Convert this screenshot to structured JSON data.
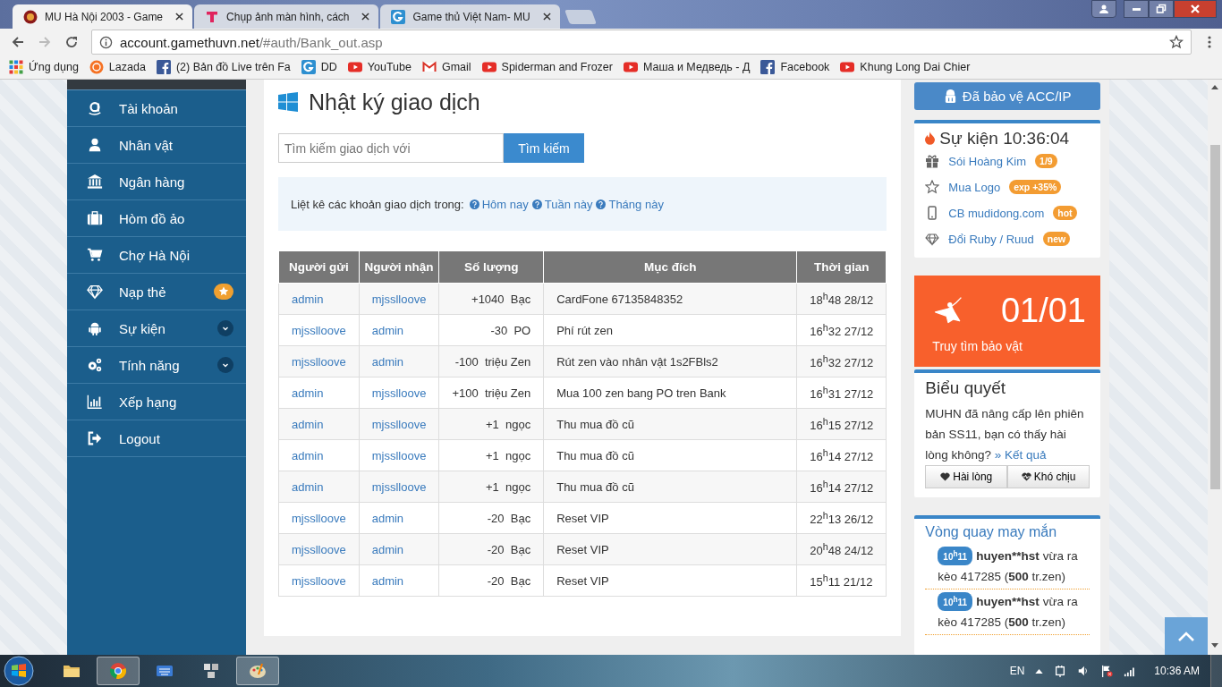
{
  "browser": {
    "tabs": [
      {
        "title": "MU Hà Nội 2003 - Game",
        "selected": true
      },
      {
        "title": "Chụp ảnh màn hình, cách",
        "selected": false
      },
      {
        "title": "Game thủ Việt Nam- MU",
        "selected": false
      }
    ],
    "url": {
      "host": "account.gamethuvn.net",
      "path": "/#auth/Bank_out.asp"
    },
    "bookmarks": [
      {
        "label": "Ứng dụng",
        "kind": "apps"
      },
      {
        "label": "Lazada",
        "kind": "lazada"
      },
      {
        "label": "(2) Bản đồ Live trên Fa",
        "kind": "facebook"
      },
      {
        "label": "DD",
        "kind": "g"
      },
      {
        "label": "YouTube",
        "kind": "youtube"
      },
      {
        "label": "Gmail",
        "kind": "gmail"
      },
      {
        "label": "Spiderman and Frozer",
        "kind": "youtube"
      },
      {
        "label": "Маша и Медведь - Д",
        "kind": "youtube"
      },
      {
        "label": "Facebook",
        "kind": "facebook"
      },
      {
        "label": "Khung Long Dai Chier",
        "kind": "youtube"
      }
    ]
  },
  "sidebar": {
    "items": [
      {
        "label": "Tài khoản",
        "kind": "plain"
      },
      {
        "label": "Nhân vật",
        "kind": "plain"
      },
      {
        "label": "Ngân hàng",
        "kind": "plain"
      },
      {
        "label": "Hòm đồ ảo",
        "kind": "plain"
      },
      {
        "label": "Chợ Hà Nội",
        "kind": "plain"
      },
      {
        "label": "Nạp thẻ",
        "kind": "star"
      },
      {
        "label": "Sự kiện",
        "kind": "chevron"
      },
      {
        "label": "Tính năng",
        "kind": "chevron"
      },
      {
        "label": "Xếp hạng",
        "kind": "plain"
      },
      {
        "label": "Logout",
        "kind": "plain"
      }
    ]
  },
  "main": {
    "title": "Nhật ký giao dịch",
    "search": {
      "placeholder": "Tìm kiếm giao dịch với",
      "button": "Tìm kiếm"
    },
    "filter": {
      "prefix": "Liệt kê các khoản giao dịch trong:",
      "links": [
        "Hôm nay",
        "Tuần này",
        "Tháng này"
      ]
    },
    "table": {
      "columns": [
        "Người gửi",
        "Người nhận",
        "Số lượng",
        "Mục đích",
        "Thời gian"
      ],
      "rows": [
        [
          "admin",
          "mjsslloove",
          "+1040  Bạc",
          "CardFone 67135848352",
          "18$^{h}$48 28/12"
        ],
        [
          "mjsslloove",
          "admin",
          "-30  PO",
          "Phí rút zen",
          "16$^{h}$32 27/12"
        ],
        [
          "mjsslloove",
          "admin",
          "-100  triệu Zen",
          "Rút zen vào nhân vật 1s2FBls2",
          "16$^{h}$32 27/12"
        ],
        [
          "admin",
          "mjsslloove",
          "+100  triệu Zen",
          "Mua 100 zen bang PO tren Bank",
          "16$^{h}$31 27/12"
        ],
        [
          "admin",
          "mjsslloove",
          "+1  ngọc",
          "Thu mua đồ cũ",
          "16$^{h}$15 27/12"
        ],
        [
          "admin",
          "mjsslloove",
          "+1  ngọc",
          "Thu mua đồ cũ",
          "16$^{h}$14 27/12"
        ],
        [
          "admin",
          "mjsslloove",
          "+1  ngọc",
          "Thu mua đồ cũ",
          "16$^{h}$14 27/12"
        ],
        [
          "mjsslloove",
          "admin",
          "-20  Bạc",
          "Reset VIP",
          "22$^{h}$13 26/12"
        ],
        [
          "mjsslloove",
          "admin",
          "-20  Bạc",
          "Reset VIP",
          "20$^{h}$48 24/12"
        ],
        [
          "mjsslloove",
          "admin",
          "-20  Bạc",
          "Reset VIP",
          "15$^{h}$11 21/12"
        ]
      ]
    }
  },
  "right": {
    "protect_button": "Đã bảo vệ ACC/IP",
    "events": {
      "title": "Sự kiện 10:36:04",
      "items": [
        {
          "label": "Sói Hoàng Kim",
          "badge": "1/9"
        },
        {
          "label": "Mua Logo",
          "badge": "exp +35%"
        },
        {
          "label": "CB mudidong.com",
          "badge": "hot"
        },
        {
          "label": "Đổi Ruby / Ruud",
          "badge": "new"
        }
      ]
    },
    "treasure": {
      "count": "01/01",
      "label": "Truy tìm bảo vật"
    },
    "poll": {
      "title": "Biểu quyết",
      "question": "MUHN đã nâng cấp lên phiên bản SS11, bạn có thấy hài lòng không?",
      "result_link": "» Kết quả",
      "buttons": [
        "Hài lòng",
        "Khó chịu"
      ]
    },
    "lucky": {
      "title": "Vòng quay may mắn",
      "entries": [
        {
          "time": "10$^{h}$11",
          "user": "huyen**hst",
          "action": "vừa ra",
          "result": "kèo 417285 (**500** tr.zen)"
        },
        {
          "time": "10$^{h}$11",
          "user": "huyen**hst",
          "action": "vừa ra",
          "result": "kèo 417285 (**500** tr.zen)"
        }
      ]
    }
  },
  "taskbar": {
    "apps": [
      {
        "selected": false
      },
      {
        "selected": true
      },
      {
        "selected": false
      },
      {
        "selected": false
      },
      {
        "selected": true
      }
    ],
    "language": "EN",
    "clock": "10:36 AM"
  }
}
